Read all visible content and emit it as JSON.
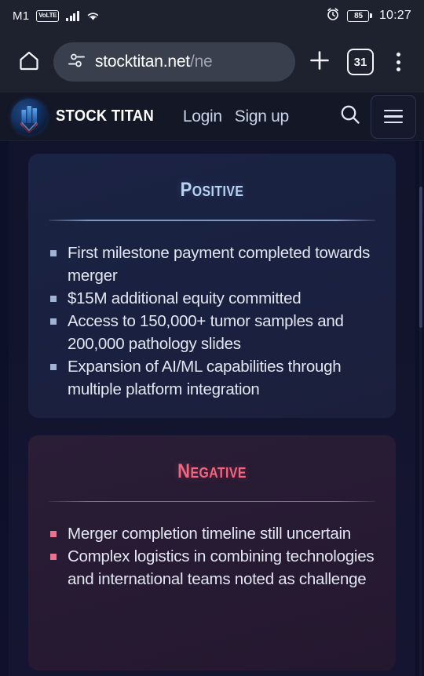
{
  "status_bar": {
    "carrier": "M1",
    "network_badge": "VoLTE",
    "signal_icon": "cellular-signal-icon",
    "wifi_icon": "wifi-icon",
    "alarm_icon": "alarm-clock-icon",
    "battery_level": "85",
    "time": "10:27"
  },
  "browser": {
    "home_icon": "home-icon",
    "site_settings_icon": "page-settings-icon",
    "url_main": "stocktitan.net",
    "url_path": "/ne",
    "new_tab_icon": "plus-icon",
    "tab_count": "31",
    "overflow_icon": "more-vertical-icon"
  },
  "site_header": {
    "logo_icon": "stock-titan-logo-icon",
    "brand": "STOCK TITAN",
    "login_label": "Login",
    "signup_label": "Sign up",
    "search_icon": "search-icon",
    "menu_icon": "hamburger-menu-icon"
  },
  "cards": {
    "positive": {
      "title": "Positive",
      "accent": "#bad3f5",
      "bullet_color": "#9fb3d4",
      "items": [
        "First milestone payment completed towards merger",
        "$15M additional equity committed",
        "Access to 150,000+ tumor samples and 200,000 pathology slides",
        "Expansion of AI/ML capabilities through multiple platform integration"
      ]
    },
    "negative": {
      "title": "Negative",
      "accent": "#f4657f",
      "bullet_color": "#e8728f",
      "items": [
        "Merger completion timeline still uncertain",
        "Complex logistics in combining technologies and international teams noted as challenge"
      ]
    }
  }
}
